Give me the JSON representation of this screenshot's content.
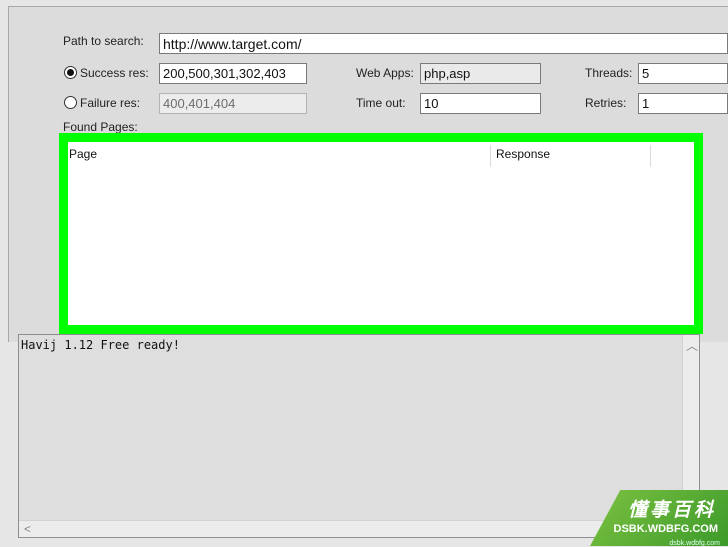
{
  "form": {
    "path_label": "Path to search:",
    "path_value": "http://www.target.com/",
    "success_label": "Success res:",
    "success_value": "200,500,301,302,403",
    "failure_label": "Failure res:",
    "failure_value": "400,401,404",
    "webapps_label": "Web Apps:",
    "webapps_value": "php,asp",
    "timeout_label": "Time out:",
    "timeout_value": "10",
    "threads_label": "Threads:",
    "threads_value": "5",
    "retries_label": "Retries:",
    "retries_value": "1",
    "selected_radio": "success"
  },
  "found_pages": {
    "label": "Found Pages:",
    "columns": [
      "Page",
      "Response"
    ],
    "rows": [],
    "highlight_color": "#00ff00"
  },
  "log": {
    "text": "Havij 1.12 Free ready!"
  },
  "watermark": {
    "title": "懂事百科",
    "site": "DSBK.WDBFG.COM",
    "small": "dsbk.wdbfg.com"
  }
}
